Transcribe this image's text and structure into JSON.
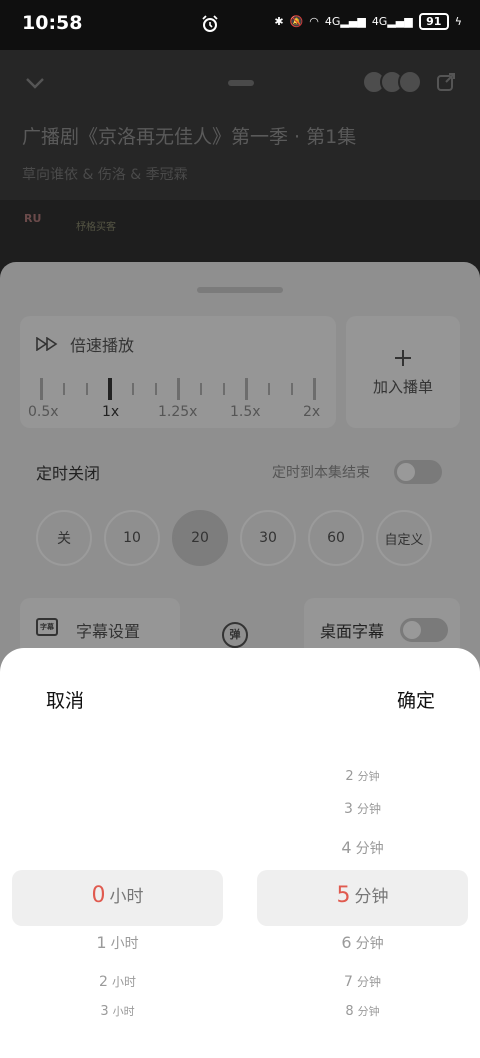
{
  "status_bar": {
    "time": "10:58",
    "network_1": "4G",
    "network_2": "4G",
    "battery": "91"
  },
  "player": {
    "title": "广播剧《京洛再无佳人》第一季 · 第1集",
    "subtitle": "草向谁依 & 伤洛 & 季冠霖",
    "logo_text": "RU",
    "cover_text": "杼格买客"
  },
  "panel": {
    "speed": {
      "title": "倍速播放",
      "options": [
        "0.5x",
        "1x",
        "1.25x",
        "1.5x",
        "2x"
      ],
      "selected": "1x"
    },
    "add_playlist_label": "加入播单",
    "timer": {
      "title": "定时关闭",
      "end_label": "定时到本集结束",
      "end_enabled": false,
      "options": [
        "关",
        "10",
        "20",
        "30",
        "60",
        "自定义"
      ],
      "selected": "20"
    },
    "subtitle_settings_label": "字幕设置",
    "subtitle_icon_text": "字幕",
    "danmu_icon_text": "弹",
    "desktop_subtitle_label": "桌面字幕",
    "desktop_subtitle_enabled": false
  },
  "picker": {
    "cancel_label": "取消",
    "confirm_label": "确定",
    "hours_unit": "小时",
    "minutes_unit": "分钟",
    "hours_selected": "0",
    "minutes_selected": "5",
    "hours_below": [
      "1",
      "2",
      "3"
    ],
    "minutes_above": [
      "2",
      "3",
      "4"
    ],
    "minutes_below": [
      "6",
      "7",
      "8"
    ]
  },
  "colors": {
    "accent": "#e05a4f"
  }
}
